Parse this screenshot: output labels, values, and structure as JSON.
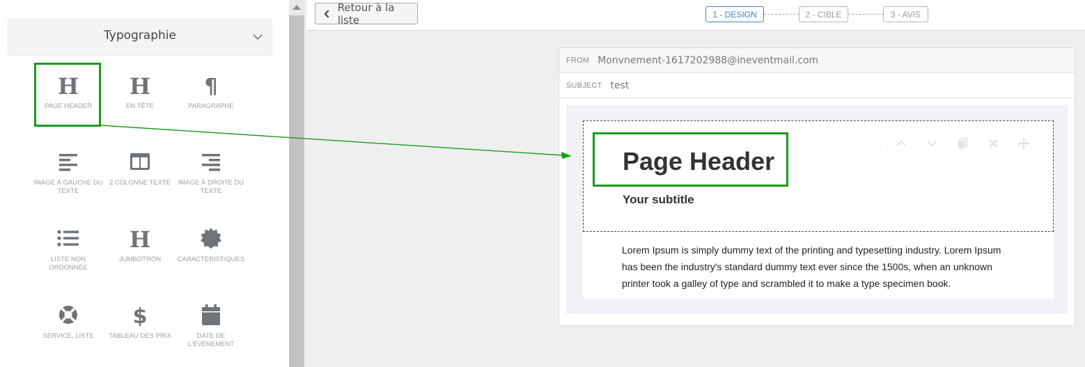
{
  "sidebar": {
    "section_title": "Typographie",
    "tiles": [
      {
        "label": "PAGE HEADER",
        "icon": "heading-icon"
      },
      {
        "label": "EN TÊTE",
        "icon": "heading-icon"
      },
      {
        "label": "PARAGRAPHE",
        "icon": "paragraph-icon"
      },
      {
        "label": "IMAGE À GAUCHE DU TEXTE",
        "icon": "align-left-icon"
      },
      {
        "label": "2 COLONNE TEXTE",
        "icon": "columns-icon"
      },
      {
        "label": "IMAGE À DROITE DU TEXTE",
        "icon": "align-right-icon"
      },
      {
        "label": "LISTE NON ORDONNÉE",
        "icon": "list-icon"
      },
      {
        "label": "JUMBOTRON",
        "icon": "heading-icon"
      },
      {
        "label": "CARACTÉRISTIQUES",
        "icon": "badge-icon"
      },
      {
        "label": "SERVICE, LISTE",
        "icon": "life-ring-icon"
      },
      {
        "label": "TABLEAU DES PRIX",
        "icon": "dollar-icon"
      },
      {
        "label": "DATE DE L'ÉVÉNEMENT",
        "icon": "calendar-icon"
      }
    ]
  },
  "topbar": {
    "back_label": "Retour à la liste",
    "steps": [
      "1 - DESIGN",
      "2 - CIBLE",
      "3 - AVIS"
    ],
    "active_step": 0
  },
  "email": {
    "from_label": "FROM",
    "from_value": "Monvnement-1617202988@ineventmail.com",
    "subject_label": "SUBJECT",
    "subject_value": "test",
    "header_title": "Page Header",
    "header_subtitle": "Your subtitle",
    "body_text": "Lorem Ipsum is simply dummy text of the printing and typesetting industry. Lorem Ipsum has been the industry's standard dummy text ever since the 1500s, when an unknown printer took a galley of type and scrambled it to make a type specimen book."
  },
  "colors": {
    "highlight": "#1a9b1a",
    "active_step": "#3d7fc5",
    "icon": "#6e7479"
  }
}
